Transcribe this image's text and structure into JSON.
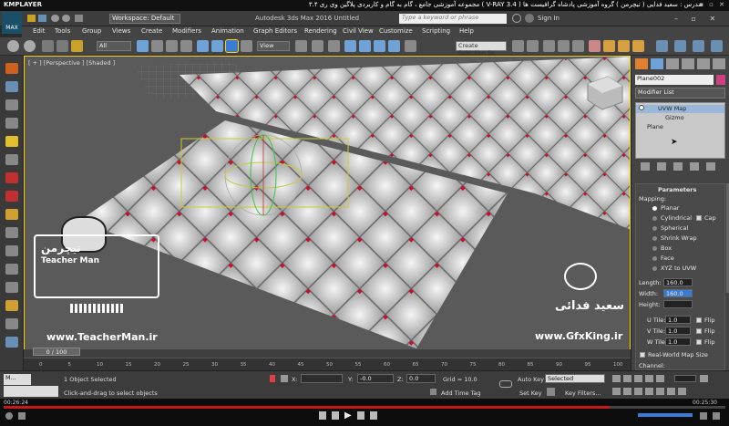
{
  "player": {
    "logo": "KMPLAYER",
    "title": "مجموعه آموزشی جامع ، گام به گام و کاربردی پلاگین وی ری ۳.۴ ( V-RAY 3.4 )   مدرس : سعید فدایی ( تیچرمن ) گروه آموزشی پادشاه گرافیست ها",
    "window_controls": "▪ ▫ ✕",
    "time_current": "00:26:24",
    "time_total": "00:25:30",
    "progress_fraction": 0.84
  },
  "max": {
    "logo": "MAX",
    "workspace": "Workspace: Default",
    "title": "Autodesk 3ds Max 2016    Untitled",
    "search_placeholder": "Type a keyword or phrase",
    "signin": "Sign In"
  },
  "menu": [
    "Edit",
    "Tools",
    "Group",
    "Views",
    "Create",
    "Modifiers",
    "Animation",
    "Graph Editors",
    "Rendering",
    "Civil View",
    "Customize",
    "Scripting",
    "Help"
  ],
  "toolbar": {
    "filter": "All",
    "view": "View",
    "selection_set": "Create Selection Se"
  },
  "viewport": {
    "label": "[ + ] [Perspective ] [Shaded ]"
  },
  "command_panel": {
    "object_name": "Plane002",
    "modifier_list": "Modifier List",
    "stack": [
      "UVW Map",
      "Gizmo",
      "Plane"
    ],
    "params_title": "Parameters",
    "mapping_label": "Mapping:",
    "mapping_options": [
      "Planar",
      "Cylindrical",
      "Spherical",
      "Shrink Wrap",
      "Box",
      "Face",
      "XYZ to UVW"
    ],
    "cap_label": "Cap",
    "length_label": "Length:",
    "length_value": "160.0",
    "width_label": "Width:",
    "width_value": "160.0",
    "height_label": "Height:",
    "height_value": "",
    "u_tile_label": "U Tile:",
    "u_tile": "1.0",
    "v_tile_label": "V Tile:",
    "v_tile": "1.0",
    "w_tile_label": "W Tile:",
    "w_tile": "1.0",
    "flip_label": "Flip",
    "real_world": "Real-World Map Size",
    "channel_label": "Channel:"
  },
  "timeline": {
    "slider": "0 / 100",
    "ticks": [
      "0",
      "5",
      "10",
      "15",
      "20",
      "25",
      "30",
      "35",
      "40",
      "45",
      "50",
      "55",
      "60",
      "65",
      "70",
      "75",
      "80",
      "85",
      "90",
      "95",
      "100"
    ]
  },
  "status": {
    "script_tab": "M...",
    "selected": "1 Object Selected",
    "prompt": "Click-and-drag to select objects",
    "x_label": "X:",
    "y_label": "Y:",
    "y_value": "-0.0",
    "z_label": "Z:",
    "z_value": "0.0",
    "grid": "Grid = 10.0",
    "add_time_tag": "Add Time Tag",
    "auto_key": "Auto Key",
    "auto_key_value": "Selected",
    "set_key": "Set Key",
    "key_filters": "Key Filters..."
  },
  "watermark": {
    "teacher_persian": "تیچرمن",
    "teacher_name": "Teacher Man",
    "teacher_url": "www.TeacherMan.ir",
    "gfx_persian": "سعید فدائی",
    "gfx_url": "www.GfxKing.ir"
  },
  "colors": {
    "tile_red": "#c8102e",
    "tile_light": "#d8d8d8",
    "accent_blue": "#3a7bd5",
    "selection_yellow": "#ffd400"
  }
}
